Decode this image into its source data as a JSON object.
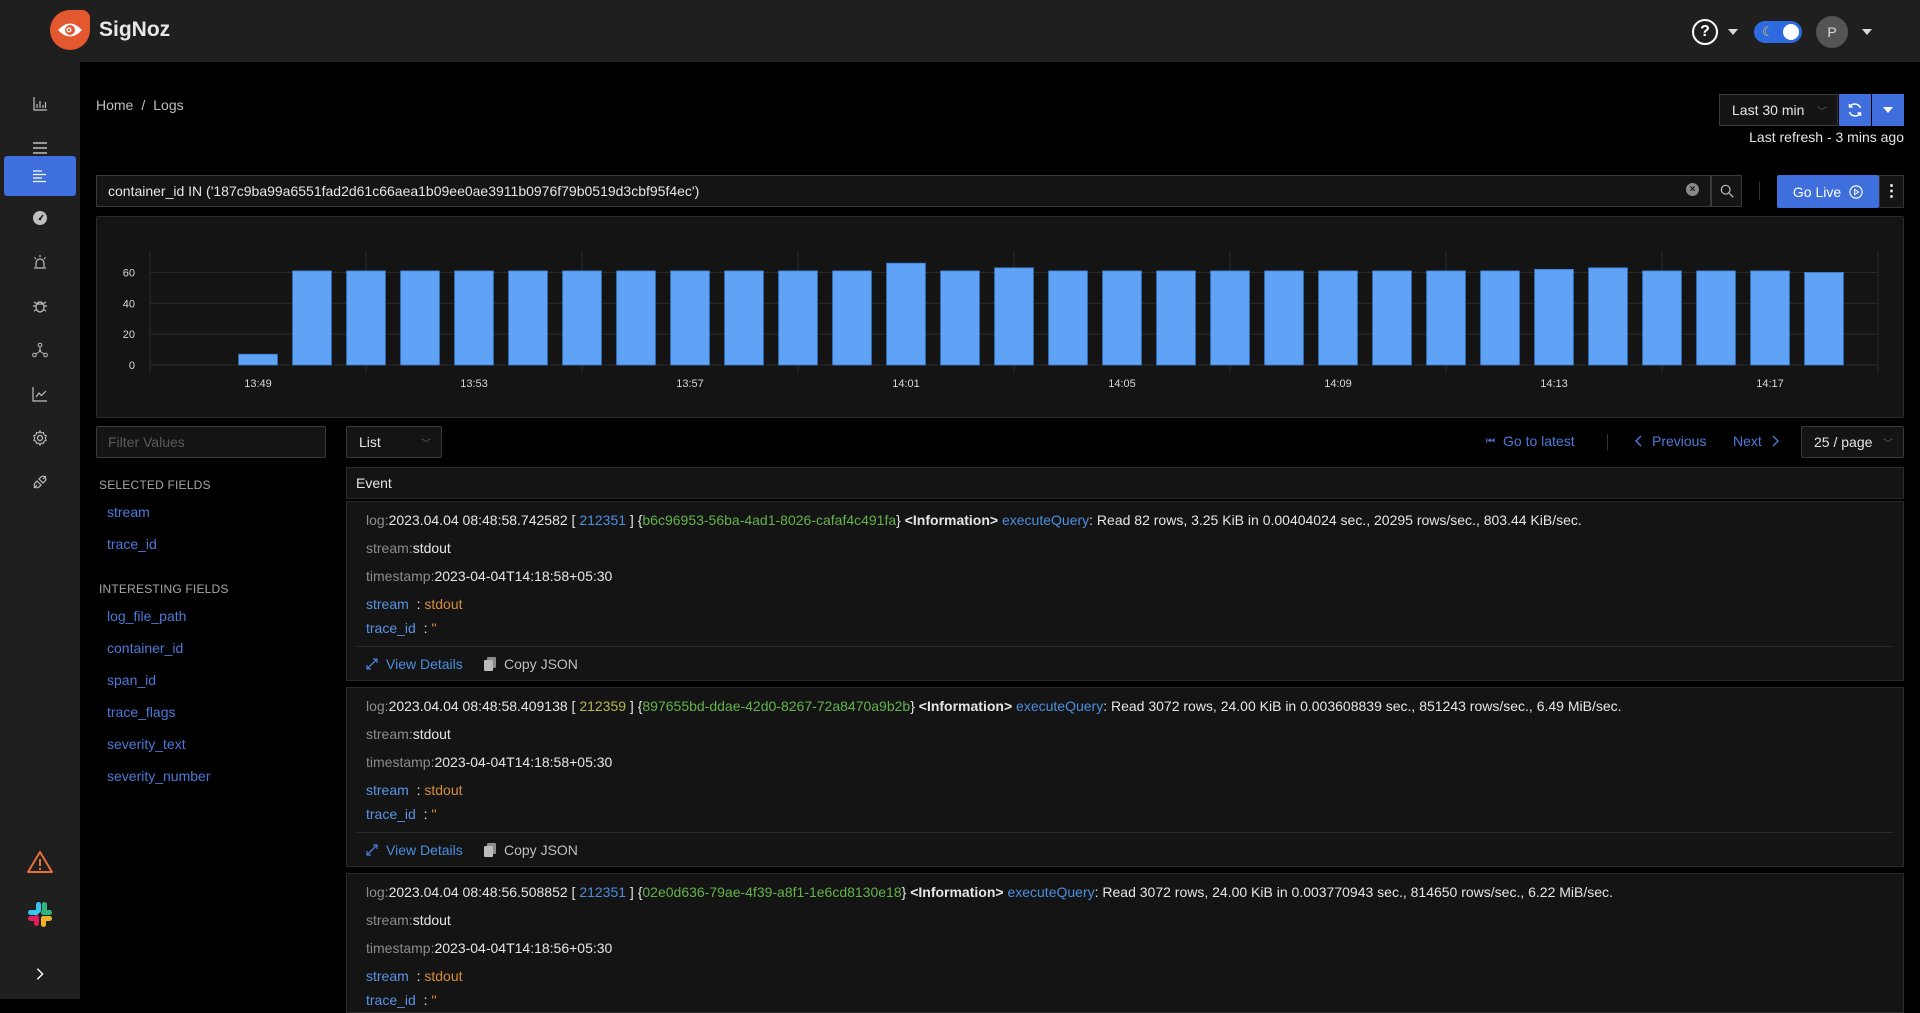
{
  "app": {
    "name": "SigNoz"
  },
  "header": {
    "avatar_initial": "P"
  },
  "sidebar": {
    "items": [
      {
        "id": "services",
        "icon": "bar-chart-icon"
      },
      {
        "id": "traces",
        "icon": "menu-icon"
      },
      {
        "id": "logs",
        "icon": "logs-icon",
        "active": true
      },
      {
        "id": "dashboards",
        "icon": "dashboard-icon"
      },
      {
        "id": "alerts",
        "icon": "alarm-icon"
      },
      {
        "id": "exceptions",
        "icon": "bug-icon"
      },
      {
        "id": "service-map",
        "icon": "deployment-unit-icon"
      },
      {
        "id": "usage-explorer",
        "icon": "line-chart-icon"
      },
      {
        "id": "settings",
        "icon": "gear-icon"
      },
      {
        "id": "get-started",
        "icon": "api-icon"
      }
    ],
    "bottom": [
      {
        "id": "version-warning",
        "icon": "warning-icon"
      },
      {
        "id": "slack",
        "icon": "slack-icon"
      },
      {
        "id": "collapse",
        "icon": "chevron-right-icon"
      }
    ]
  },
  "breadcrumb": {
    "home": "Home",
    "separator": "/",
    "current": "Logs"
  },
  "time": {
    "range": "Last 30 min",
    "last_refresh": "Last refresh - 3 mins ago"
  },
  "search": {
    "query": "container_id IN ('187c9ba99a6551fad2d61c66aea1b09ee0ae3911b0976f79b0519d3cbf95f4ec')"
  },
  "go_live": {
    "label": "Go Live"
  },
  "chart_data": {
    "type": "bar",
    "title": "",
    "xlabel": "",
    "ylabel": "",
    "ylim": [
      0,
      70
    ],
    "yticks": [
      0,
      20,
      40,
      60
    ],
    "xtick_labels": [
      "13:49",
      "13:53",
      "13:57",
      "14:01",
      "14:05",
      "14:09",
      "14:13",
      "14:17"
    ],
    "categories": [
      "13:49",
      "13:50",
      "13:51",
      "13:52",
      "13:53",
      "13:54",
      "13:55",
      "13:56",
      "13:57",
      "13:58",
      "13:59",
      "14:00",
      "14:01",
      "14:02",
      "14:03",
      "14:04",
      "14:05",
      "14:06",
      "14:07",
      "14:08",
      "14:09",
      "14:10",
      "14:11",
      "14:12",
      "14:13",
      "14:14",
      "14:15",
      "14:16",
      "14:17",
      "14:18"
    ],
    "values": [
      7,
      61,
      61,
      61,
      61,
      61,
      61,
      61,
      61,
      61,
      61,
      61,
      66,
      61,
      63,
      61,
      61,
      61,
      61,
      61,
      61,
      61,
      61,
      61,
      62,
      63,
      61,
      61,
      61,
      60
    ],
    "color": "#5ea3f5",
    "grid": true
  },
  "filters": {
    "placeholder": "Filter Values"
  },
  "view_mode": {
    "selected": "List"
  },
  "pagination": {
    "go_latest": "Go to latest",
    "previous": "Previous",
    "next": "Next",
    "page_size": "25 / page"
  },
  "fields": {
    "selected_title": "SELECTED FIELDS",
    "selected": [
      "stream",
      "trace_id"
    ],
    "interesting_title": "INTERESTING FIELDS",
    "interesting": [
      "log_file_path",
      "container_id",
      "span_id",
      "trace_flags",
      "severity_text",
      "severity_number"
    ]
  },
  "table": {
    "column": "Event"
  },
  "logs": [
    {
      "log_label": "log:",
      "datetime": "2023.04.04 08:48:58.742582 [ ",
      "thread_id": "212351",
      "thread_color": "blue",
      "mid": " ] {",
      "query_id": "b6c96953-56ba-4ad1-8026-cafaf4c491fa",
      "close": "} ",
      "level": "<Information>",
      "source": "executeQuery",
      "message": ": Read 82 rows, 3.25 KiB in 0.00404024 sec., 20295 rows/sec., 803.44 KiB/sec.",
      "stream_label": "stream:",
      "stream": "stdout",
      "timestamp_label": "timestamp:",
      "timestamp": "2023-04-04T14:18:58+05:30",
      "attr_stream_key": "stream",
      "attr_stream_val": "stdout",
      "attr_trace_key": "trace_id",
      "attr_trace_val": "''",
      "view_details": "View Details",
      "copy_json": "Copy JSON"
    },
    {
      "log_label": "log:",
      "datetime": "2023.04.04 08:48:58.409138 [ ",
      "thread_id": "212359",
      "thread_color": "olive",
      "mid": " ] {",
      "query_id": "897655bd-ddae-42d0-8267-72a8470a9b2b",
      "close": "} ",
      "level": "<Information>",
      "source": "executeQuery",
      "message": ": Read 3072 rows, 24.00 KiB in 0.003608839 sec., 851243 rows/sec., 6.49 MiB/sec.",
      "stream_label": "stream:",
      "stream": "stdout",
      "timestamp_label": "timestamp:",
      "timestamp": "2023-04-04T14:18:58+05:30",
      "attr_stream_key": "stream",
      "attr_stream_val": "stdout",
      "attr_trace_key": "trace_id",
      "attr_trace_val": "''",
      "view_details": "View Details",
      "copy_json": "Copy JSON"
    },
    {
      "log_label": "log:",
      "datetime": "2023.04.04 08:48:56.508852 [ ",
      "thread_id": "212351",
      "thread_color": "blue",
      "mid": " ] {",
      "query_id": "02e0d636-79ae-4f39-a8f1-1e6cd8130e18",
      "close": "} ",
      "level": "<Information>",
      "source": "executeQuery",
      "message": ": Read 3072 rows, 24.00 KiB in 0.003770943 sec., 814650 rows/sec., 6.22 MiB/sec.",
      "stream_label": "stream:",
      "stream": "stdout",
      "timestamp_label": "timestamp:",
      "timestamp": "2023-04-04T14:18:56+05:30",
      "attr_stream_key": "stream",
      "attr_stream_val": "stdout",
      "attr_trace_key": "trace_id",
      "attr_trace_val": "''"
    }
  ]
}
